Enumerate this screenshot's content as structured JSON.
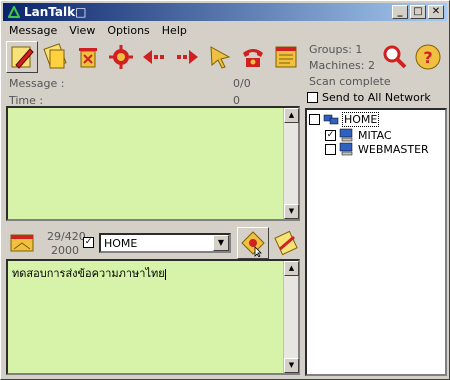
{
  "window": {
    "title": "LanTalk□"
  },
  "menu": [
    "Message",
    "View",
    "Options",
    "Help"
  ],
  "status": {
    "groups": "Groups: 1",
    "machines": "Machines: 2",
    "scan": "Scan complete"
  },
  "labels": {
    "message": "Message :",
    "time": "Time :",
    "message_count": "0/0",
    "time_value": "0",
    "char_count": "29/420",
    "char_limit": "2000",
    "send_all": "Send to All Network"
  },
  "target": {
    "selected": "HOME"
  },
  "compose": {
    "text": "ทดสอบการส่งข้อความภาษาไทย"
  },
  "tree": {
    "root": "HOME",
    "children": [
      "MITAC",
      "WEBMASTER"
    ]
  },
  "icons": {
    "toolbar": [
      "new-message-icon",
      "open-message-icon",
      "delete-icon",
      "settings-icon",
      "previous-icon",
      "next-icon",
      "pointer-icon",
      "phone-icon",
      "window-icon"
    ],
    "accent": "#c00000",
    "yellow": "#f0c000"
  }
}
